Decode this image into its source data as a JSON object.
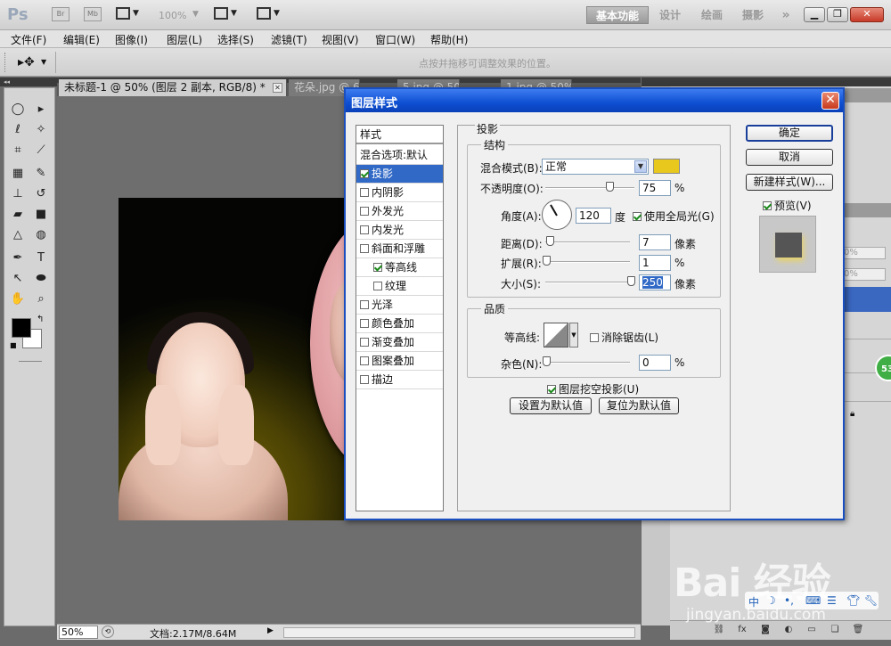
{
  "app": {
    "logo": "Ps",
    "bridge_label": "Br",
    "minibridge_label": "Mb",
    "zoom_level": "100%",
    "workspaces": [
      "基本功能",
      "设计",
      "绘画",
      "摄影"
    ],
    "more_label": "»"
  },
  "menu": [
    "文件(F)",
    "编辑(E)",
    "图像(I)",
    "图层(L)",
    "选择(S)",
    "滤镜(T)",
    "视图(V)",
    "窗口(W)",
    "帮助(H)"
  ],
  "options_bar": {
    "hint": "点按并拖移可调整效果的位置。"
  },
  "tabs": [
    {
      "label": "未标题-1 @ 50% (图层 2 副本, RGB/8) *",
      "active": true
    },
    {
      "label": "花朵.jpg @ 6"
    },
    {
      "label": "5.jpg @ 50%"
    },
    {
      "label": "1.jpg @ 50%"
    }
  ],
  "status": {
    "zoom": "50%",
    "doc_info": "文档:2.17M/8.64M"
  },
  "dialog": {
    "title": "图层样式",
    "close_glyph": "✕",
    "styles_header": "样式",
    "blend_options": "混合选项:默认",
    "styles": [
      {
        "label": "投影",
        "checked": true,
        "selected": true
      },
      {
        "label": "内阴影",
        "checked": false
      },
      {
        "label": "外发光",
        "checked": false
      },
      {
        "label": "内发光",
        "checked": false
      },
      {
        "label": "斜面和浮雕",
        "checked": false
      },
      {
        "label": "等高线",
        "checked": true,
        "sub": true
      },
      {
        "label": "纹理",
        "checked": false,
        "sub": true
      },
      {
        "label": "光泽",
        "checked": false
      },
      {
        "label": "颜色叠加",
        "checked": false
      },
      {
        "label": "渐变叠加",
        "checked": false
      },
      {
        "label": "图案叠加",
        "checked": false
      },
      {
        "label": "描边",
        "checked": false
      }
    ],
    "section": "投影",
    "structure": {
      "group_label": "结构",
      "blend_mode_label": "混合模式(B):",
      "blend_mode_value": "正常",
      "shadow_color": "#e8c81c",
      "opacity_label": "不透明度(O):",
      "opacity_value": "75",
      "opacity_unit": "%",
      "angle_label": "角度(A):",
      "angle_value": "120",
      "angle_unit": "度",
      "global_light_label": "使用全局光(G)",
      "global_light_checked": true,
      "distance_label": "距离(D):",
      "distance_value": "7",
      "distance_unit": "像素",
      "spread_label": "扩展(R):",
      "spread_value": "1",
      "spread_unit": "%",
      "size_label": "大小(S):",
      "size_value": "250",
      "size_unit": "像素"
    },
    "quality": {
      "group_label": "品质",
      "contour_label": "等高线:",
      "antialias_label": "消除锯齿(L)",
      "antialias_checked": false,
      "noise_label": "杂色(N):",
      "noise_value": "0",
      "noise_unit": "%"
    },
    "knockout_label": "图层挖空投影(U)",
    "knockout_checked": true,
    "set_default_label": "设置为默认值",
    "reset_default_label": "复位为默认值",
    "ok_label": "确定",
    "cancel_label": "取消",
    "new_style_label": "新建样式(W)...",
    "preview_label": "预览(V)",
    "preview_checked": true
  },
  "right_panel": {
    "field_1": "0%",
    "field_2": "0%",
    "badge": "53"
  },
  "watermark": {
    "logo": "Bai 经验",
    "url": "jingyan.baidu.com"
  }
}
